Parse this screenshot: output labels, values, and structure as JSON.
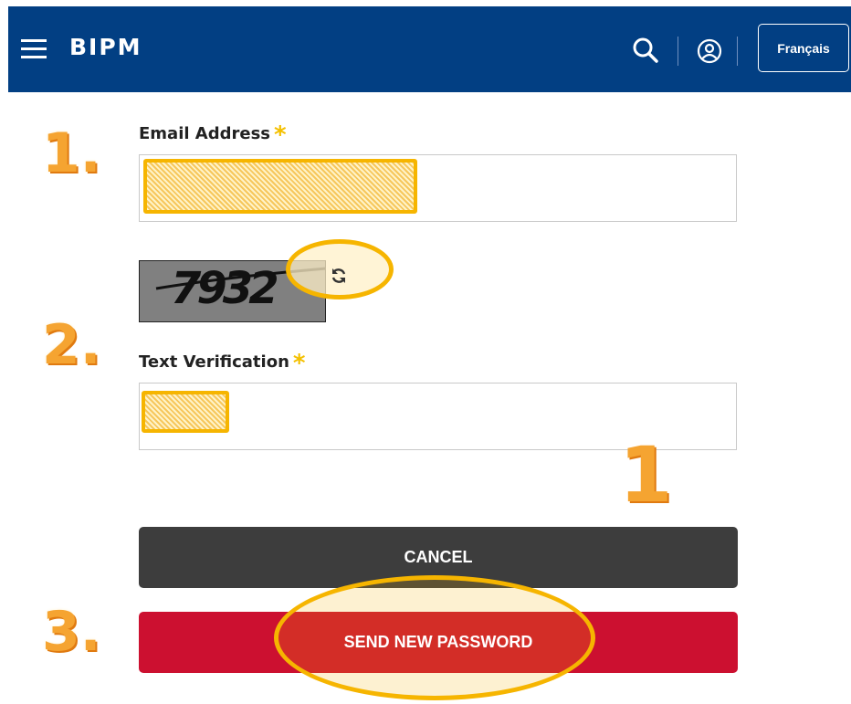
{
  "header": {
    "brand": "BIPM",
    "language_button": "Français",
    "background_color": "#023f83",
    "icons": [
      "hamburger-menu-icon",
      "search-icon",
      "user-account-icon"
    ]
  },
  "steps": {
    "step1": "1.",
    "step2": "2.",
    "step3": "3."
  },
  "form": {
    "email_label": "Email Address",
    "email_required_marker": "*",
    "captcha_text": "7932",
    "refresh_icon": "refresh-icon",
    "text_verification_label": "Text Verification",
    "text_verification_required_marker": "*",
    "annotation_number": "1",
    "cancel_button": "CANCEL",
    "send_button": "SEND NEW PASSWORD"
  },
  "colors": {
    "accent_highlight": "#f6b500",
    "cancel_button": "#3d3d3d",
    "send_button": "#cc1030",
    "step_numeral": "#f5a431"
  }
}
